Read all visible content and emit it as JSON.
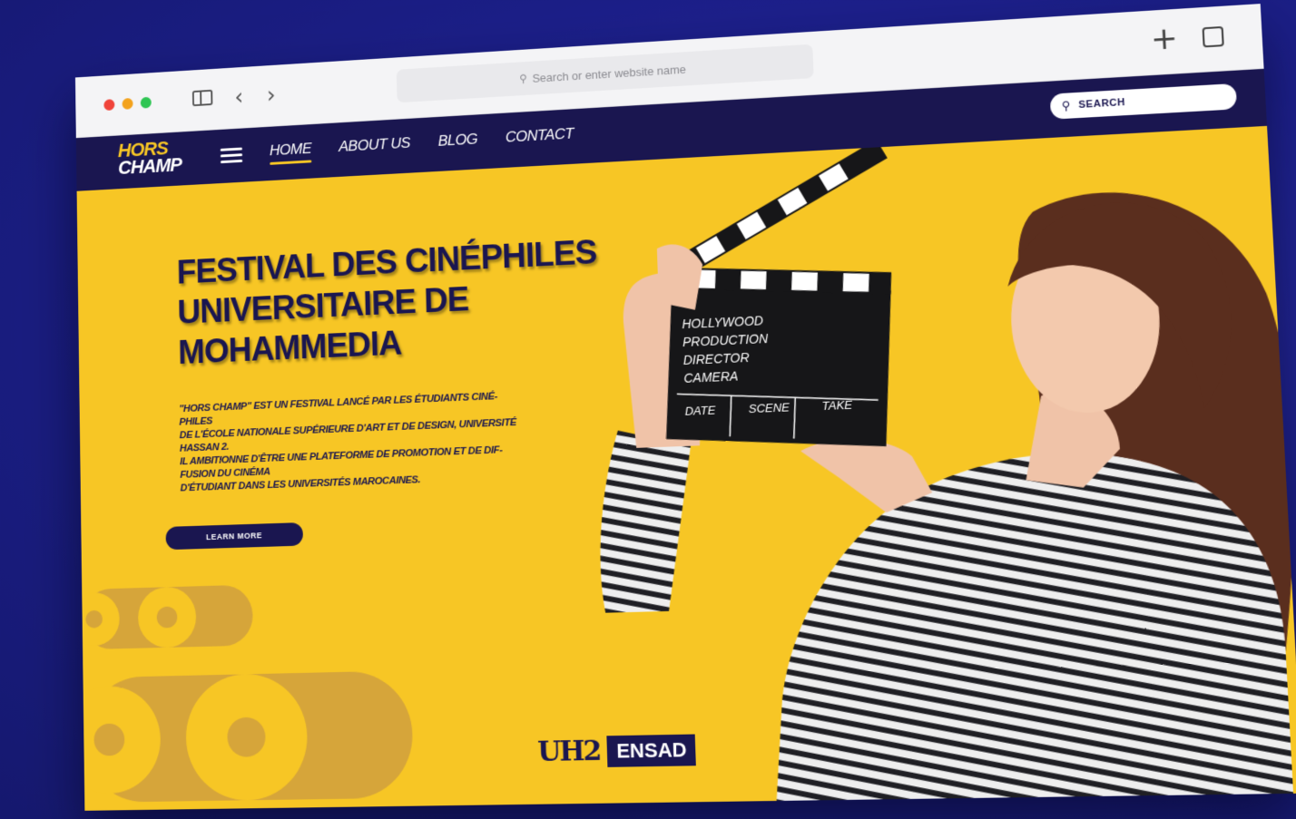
{
  "browser": {
    "address_placeholder": "Search or enter website name",
    "icons": [
      "close-dot",
      "minimize-dot",
      "zoom-dot",
      "sidebar-icon",
      "back-icon",
      "forward-icon",
      "search-icon",
      "plus-icon",
      "tabs-icon"
    ]
  },
  "navbar": {
    "logo_line1": "HORS",
    "logo_line2": "CHAMP",
    "links": [
      {
        "label": "HOME",
        "active": true
      },
      {
        "label": "ABOUT US"
      },
      {
        "label": "BLOG"
      },
      {
        "label": "CONTACT"
      }
    ],
    "search_placeholder": "SEARCH"
  },
  "hero": {
    "title_lines": [
      "FESTIVAL DES CINÉPHILES",
      "UNIVERSITAIRE DE",
      "MOHAMMEDIA"
    ],
    "description_lines": [
      "\"HORS CHAMP\" EST UN FESTIVAL LANCÉ PAR LES ÉTUDIANTS CINÉ-",
      "PHILES",
      "DE L'ÉCOLE NATIONALE SUPÉRIEURE D'ART ET DE DESIGN, UNIVERSITÉ",
      "HASSAN 2.",
      "IL AMBITIONNE D'ÊTRE UNE PLATEFORME DE PROMOTION ET DE DIF-",
      "FUSION DU CINÉMA",
      "D'ÉTUDIANT DANS LES UNIVERSITÉS MAROCAINES."
    ],
    "cta_label": "LEARN MORE",
    "clapper_lines": [
      "HOLLYWOOD",
      "PRODUCTION",
      "DIRECTOR",
      "CAMERA"
    ],
    "clapper_columns": [
      "DATE",
      "SCENE",
      "TAKE"
    ],
    "partner_logo_1": "UH2",
    "partner_logo_2": "ENSAD"
  },
  "colors": {
    "background": "#1c1f8c",
    "hero_yellow": "#f7c625",
    "navy": "#1a1650",
    "reel_gold": "#d6a53a"
  }
}
